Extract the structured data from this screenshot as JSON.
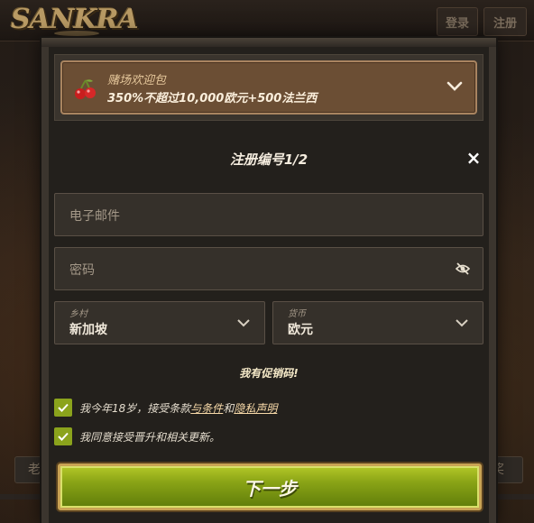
{
  "site": {
    "logo": "SANKRA",
    "login_label": "登录",
    "register_label": "注册",
    "bg_left_label": "老",
    "bg_right_label": "奖"
  },
  "bonus": {
    "title": "赌场欢迎包",
    "subtitle": "350%不超过10,000欧元+500法兰西",
    "icon": "cherry-icon"
  },
  "form": {
    "title": "注册编号1/2",
    "close": "×",
    "email_placeholder": "电子邮件",
    "password_placeholder": "密码",
    "country_label": "乡村",
    "country_value": "新加坡",
    "currency_label": "货币",
    "currency_value": "欧元",
    "promo_link": "我有促销码!",
    "age_prefix": "我今年18岁，接受条款",
    "age_terms": "与条件",
    "age_and": "和",
    "age_privacy": "隐私声明",
    "consent": "我同意接受晋升和相关更新。",
    "next_button": "下一步"
  },
  "colors": {
    "accent_green": "#8ba31c",
    "gold_border": "#c9a354",
    "bonus_bg": "#6b4e34"
  }
}
